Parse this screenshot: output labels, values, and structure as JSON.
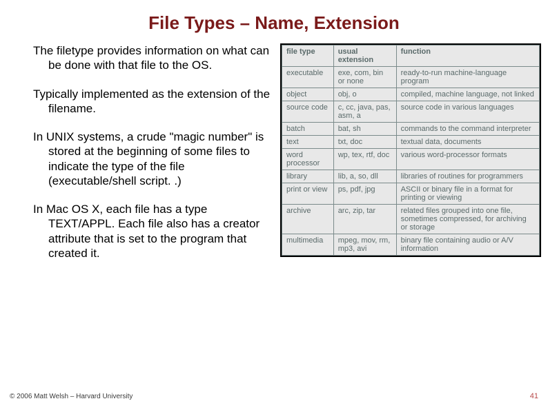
{
  "title": "File Types – Name, Extension",
  "paragraphs": [
    "The filetype provides information on what can be done with that file to the OS.",
    "Typically implemented as the extension of the filename.",
    "In UNIX systems, a crude \"magic number\" is stored at the beginning of some files to indicate the type of the file (executable/shell script. .)",
    "In Mac OS X, each file has a type TEXT/APPL. Each file also has a creator attribute that is set to the program that created it."
  ],
  "table": {
    "headers": [
      "file type",
      "usual extension",
      "function"
    ],
    "rows": [
      [
        "executable",
        "exe, com, bin or none",
        "ready-to-run machine-language program"
      ],
      [
        "object",
        "obj, o",
        "compiled, machine language, not linked"
      ],
      [
        "source code",
        "c, cc, java, pas, asm, a",
        "source code in various languages"
      ],
      [
        "batch",
        "bat, sh",
        "commands to the command interpreter"
      ],
      [
        "text",
        "txt, doc",
        "textual data, documents"
      ],
      [
        "word processor",
        "wp, tex, rtf, doc",
        "various word-processor formats"
      ],
      [
        "library",
        "lib, a, so, dll",
        "libraries of routines for programmers"
      ],
      [
        "print or view",
        "ps, pdf, jpg",
        "ASCII or binary file in a format for printing or viewing"
      ],
      [
        "archive",
        "arc, zip, tar",
        "related files grouped into one file, sometimes compressed, for archiving or storage"
      ],
      [
        "multimedia",
        "mpeg, mov, rm, mp3, avi",
        "binary file containing audio or A/V information"
      ]
    ]
  },
  "footer": {
    "copyright": "© 2006 Matt Welsh – Harvard University",
    "page": "41"
  }
}
